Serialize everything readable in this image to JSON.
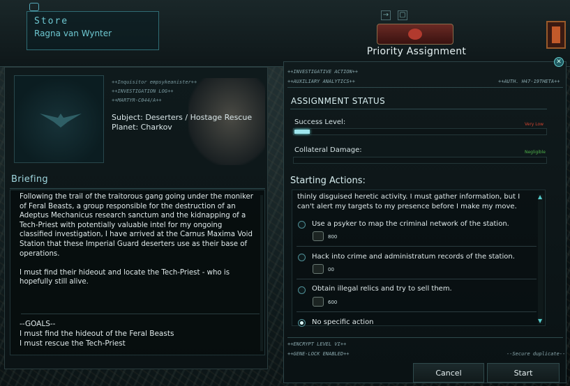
{
  "store": {
    "title": "Store",
    "name": "Ragna van Wynter"
  },
  "dossier": {
    "tags": [
      "++Inquisitor empsykeanister++",
      "++INVESTIGATION LOG++",
      "++MARTYR-C044/A++"
    ],
    "subject": "Subject: Deserters / Hostage Rescue",
    "planet": "Planet: Charkov"
  },
  "briefing": {
    "heading": "Briefing",
    "text": "Following the trail of the traitorous gang going under the moniker of Feral Beasts, a group responsible for the destruction of an Adeptus Mechanicus research sanctum and the kidnapping of a Tech-Priest with potentially valuable intel for my ongoing classified investigation, I have arrived at the Carnus Maxima Void Station that these Imperial Guard deserters use as their base of operations.\n\nI must find their hideout and locate the Tech-Priest - who is hopefully still alive.",
    "goals": "--GOALS--\nI must find the hideout of the Feral Beasts\nI must rescue the Tech-Priest"
  },
  "assignment": {
    "title": "Priority Assignment",
    "tag_tl1": "++INVESTIGATIVE ACTION++",
    "tag_tl2": "++AUXILIARY ANALYTICS++",
    "tag_tr": "++AUTH. H47-19THETA++",
    "status_heading": "ASSIGNMENT STATUS",
    "success_label": "Success Level:",
    "success_value": "Very Low",
    "success_fraction": 0.06,
    "collateral_label": "Collateral Damage:",
    "collateral_value": "Negligible",
    "collateral_fraction": 0.0,
    "actions_heading": "Starting Actions:",
    "intro": "thinly disguised heretic activity. I must gather information, but I\ncan't alert my targets to my presence before I make my move.",
    "options": [
      {
        "label": "Use a psyker to map the criminal network of the station.",
        "cost": "800"
      },
      {
        "label": "Hack into crime and administratum records of the station.",
        "cost": "00"
      },
      {
        "label": "Obtain illegal relics and try to sell them.",
        "cost": "600"
      },
      {
        "label": "No specific action",
        "cost": ""
      }
    ],
    "selected": "No specific action",
    "footer_tl1": "++ENCRYPT LEVEL VI++",
    "footer_tl2": "++GENE-LOCK ENABLED++",
    "footer_tr": "--Secure duplicate--",
    "cancel": "Cancel",
    "start": "Start"
  },
  "colors": {
    "accent": "#9fe6ee",
    "success_low": "#d2432f",
    "collateral_ok": "#4fb34a"
  }
}
